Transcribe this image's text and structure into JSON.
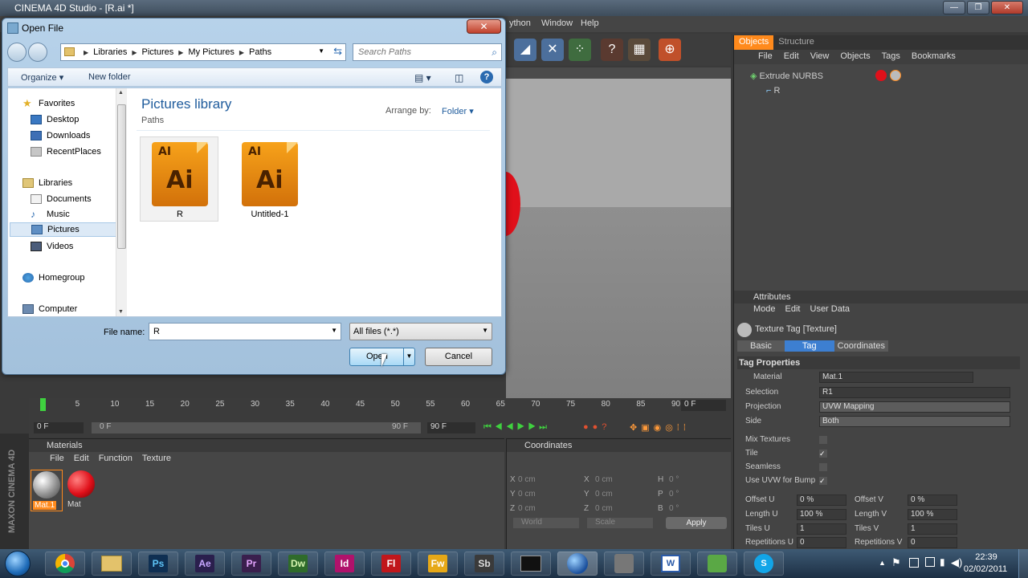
{
  "c4d": {
    "title": "CINEMA 4D Studio - [R.ai *]",
    "menus": [
      "ython",
      "Window",
      "Help"
    ],
    "objects_tabs": [
      "Objects",
      "Structure"
    ],
    "objects_menu": [
      "File",
      "Edit",
      "View",
      "Objects",
      "Tags",
      "Bookmarks"
    ],
    "tree": [
      {
        "label": "Extrude NURBS"
      },
      {
        "label": "R"
      }
    ],
    "attributes": {
      "header": "Attributes",
      "menu": [
        "Mode",
        "Edit",
        "User Data"
      ],
      "tag_title": "Texture Tag [Texture]",
      "tabs": [
        "Basic",
        "Tag",
        "Coordinates"
      ],
      "section": "Tag Properties",
      "material_label": "Material",
      "material_value": "Mat.1",
      "selection_label": "Selection",
      "selection_value": "R1",
      "projection_label": "Projection",
      "projection_value": "UVW Mapping",
      "side_label": "Side",
      "side_value": "Both",
      "mix_textures": "Mix Textures",
      "tile": "Tile",
      "seamless": "Seamless",
      "use_uvw": "Use UVW for Bump",
      "offset_u_label": "Offset U",
      "offset_u": "0 %",
      "offset_v_label": "Offset V",
      "offset_v": "0 %",
      "length_u_label": "Length U",
      "length_u": "100 %",
      "length_v_label": "Length V",
      "length_v": "100 %",
      "tiles_u_label": "Tiles U",
      "tiles_u": "1",
      "tiles_v_label": "Tiles V",
      "tiles_v": "1",
      "reps_u_label": "Repetitions U",
      "reps_u": "0",
      "reps_v_label": "Repetitions V",
      "reps_v": "0"
    },
    "timeline": {
      "ticks": [
        "0",
        "5",
        "10",
        "15",
        "20",
        "25",
        "30",
        "35",
        "40",
        "45",
        "50",
        "55",
        "60",
        "65",
        "70",
        "75",
        "80",
        "85",
        "90"
      ],
      "current_frame": "0 F",
      "start": "0 F",
      "range_start": "0 F",
      "range_end": "90 F",
      "end": "90 F"
    },
    "materials": {
      "header": "Materials",
      "menu": [
        "File",
        "Edit",
        "Function",
        "Texture"
      ],
      "items": [
        "Mat.1",
        "Mat"
      ]
    },
    "coordinates": {
      "header": "Coordinates",
      "x": "X",
      "y": "Y",
      "z": "Z",
      "h": "H",
      "p": "P",
      "b": "B",
      "value": "0 cm",
      "angle": "0 °",
      "world": "World",
      "scale": "Scale",
      "apply": "Apply"
    },
    "logo": "MAXON CINEMA 4D"
  },
  "dialog": {
    "title": "Open File",
    "close": "✕",
    "breadcrumb": [
      "Libraries",
      "Pictures",
      "My Pictures",
      "Paths"
    ],
    "search_placeholder": "Search Paths",
    "organize": "Organize ▾",
    "new_folder": "New folder",
    "nav": {
      "favorites": "Favorites",
      "desktop": "Desktop",
      "downloads": "Downloads",
      "recent": "RecentPlaces",
      "libraries": "Libraries",
      "documents": "Documents",
      "music": "Music",
      "pictures": "Pictures",
      "videos": "Videos",
      "homegroup": "Homegroup",
      "computer": "Computer"
    },
    "library_title": "Pictures library",
    "library_sub": "Paths",
    "arrange_by": "Arrange by:",
    "arrange_value": "Folder ▾",
    "files": [
      {
        "name": "R",
        "badge": "AI",
        "glyph": "Ai"
      },
      {
        "name": "Untitled-1",
        "badge": "AI",
        "glyph": "Ai"
      }
    ],
    "file_name_label": "File name:",
    "file_name_value": "R",
    "file_type": "All files (*.*)",
    "open": "Open",
    "cancel": "Cancel"
  },
  "taskbar": {
    "apps": [
      "Ps",
      "Ae",
      "Pr",
      "Dw",
      "Id",
      "Fl",
      "Fw",
      "Sb"
    ],
    "time": "22:39",
    "date": "02/02/2011"
  }
}
